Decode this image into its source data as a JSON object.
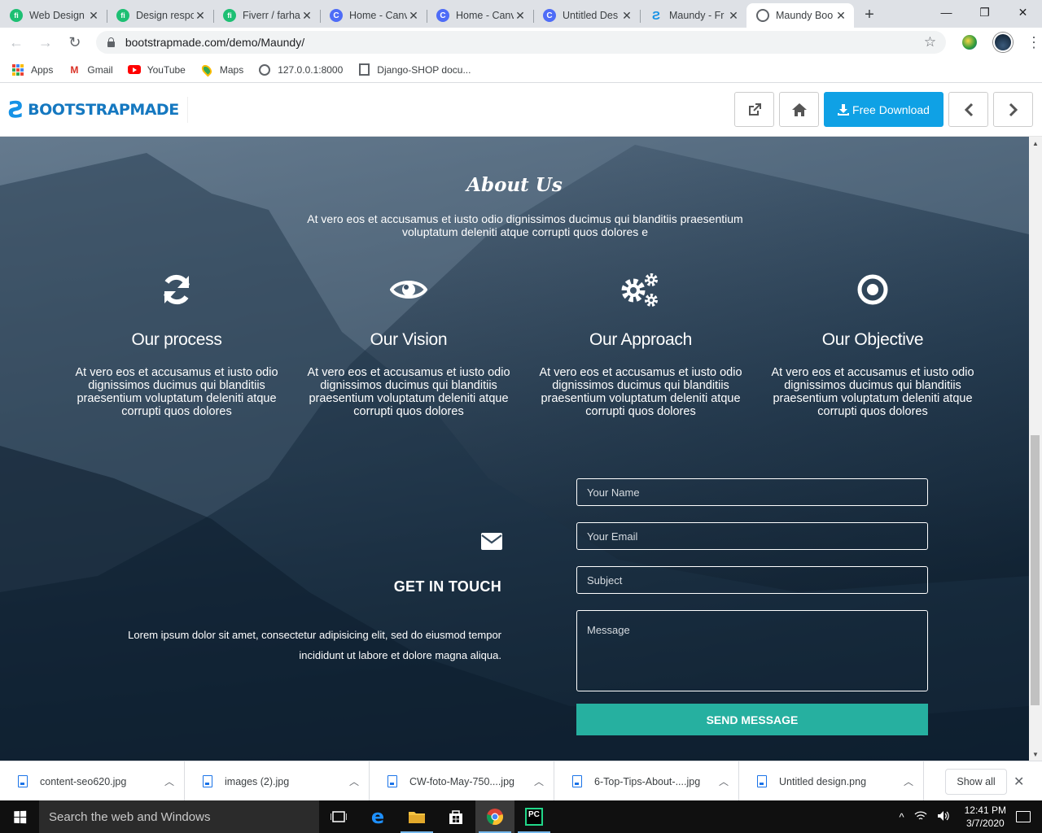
{
  "browser": {
    "tabs": [
      {
        "title": "Web Design",
        "icon": "fiverr-icon"
      },
      {
        "title": "Design respo",
        "icon": "fiverr-icon"
      },
      {
        "title": "Fiverr / farha",
        "icon": "fiverr-icon"
      },
      {
        "title": "Home - Canv",
        "icon": "canva-icon"
      },
      {
        "title": "Home - Canv",
        "icon": "canva-icon"
      },
      {
        "title": "Untitled Des",
        "icon": "canva-icon"
      },
      {
        "title": "Maundy - Fr",
        "icon": "bootstrapmade-icon"
      },
      {
        "title": "Maundy Boo",
        "icon": "globe-icon",
        "active": true
      }
    ],
    "url": "bootstrapmade.com/demo/Maundy/",
    "bookmarks": [
      {
        "label": "Apps",
        "icon": "apps-grid-icon"
      },
      {
        "label": "Gmail",
        "icon": "gmail-icon"
      },
      {
        "label": "YouTube",
        "icon": "youtube-icon"
      },
      {
        "label": "Maps",
        "icon": "maps-pin-icon"
      },
      {
        "label": "127.0.0.1:8000",
        "icon": "globe-icon"
      },
      {
        "label": "Django-SHOP docu...",
        "icon": "document-icon"
      }
    ]
  },
  "demo_header": {
    "brand": "BOOTSTRAPMADE",
    "download_label": "Free Download"
  },
  "about": {
    "title": "About Us",
    "description": "At vero eos et accusamus et iusto odio dignissimos ducimus qui blanditiis praesentium voluptatum deleniti atque corrupti quos dolores e",
    "features": [
      {
        "icon": "refresh-icon",
        "title": "Our process",
        "text": "At vero eos et accusamus et iusto odio dignissimos ducimus qui blanditiis praesentium voluptatum deleniti atque corrupti quos dolores"
      },
      {
        "icon": "eye-icon",
        "title": "Our Vision",
        "text": "At vero eos et accusamus et iusto odio dignissimos ducimus qui blanditiis praesentium voluptatum deleniti atque corrupti quos dolores"
      },
      {
        "icon": "gears-icon",
        "title": "Our Approach",
        "text": "At vero eos et accusamus et iusto odio dignissimos ducimus qui blanditiis praesentium voluptatum deleniti atque corrupti quos dolores"
      },
      {
        "icon": "target-icon",
        "title": "Our Objective",
        "text": "At vero eos et accusamus et iusto odio dignissimos ducimus qui blanditiis praesentium voluptatum deleniti atque corrupti quos dolores"
      }
    ]
  },
  "contact": {
    "icon": "envelope-icon",
    "title": "GET IN TOUCH",
    "text": "Lorem ipsum dolor sit amet, consectetur adipisicing elit, sed do eiusmod tempor incididunt ut labore et dolore magna aliqua.",
    "form": {
      "name_placeholder": "Your Name",
      "email_placeholder": "Your Email",
      "subject_placeholder": "Subject",
      "message_placeholder": "Message",
      "submit_label": "SEND MESSAGE"
    }
  },
  "downloads": {
    "items": [
      "content-seo620.jpg",
      "images (2).jpg",
      "CW-foto-May-750....jpg",
      "6-Top-Tips-About-....jpg",
      "Untitled design.png"
    ],
    "show_all_label": "Show all"
  },
  "taskbar": {
    "search_placeholder": "Search the web and Windows",
    "time": "12:41 PM",
    "date": "3/7/2020"
  },
  "colors": {
    "accent_download": "#0fa1e5",
    "send_button": "#26b0a0",
    "brand_blue": "#1592e6"
  }
}
